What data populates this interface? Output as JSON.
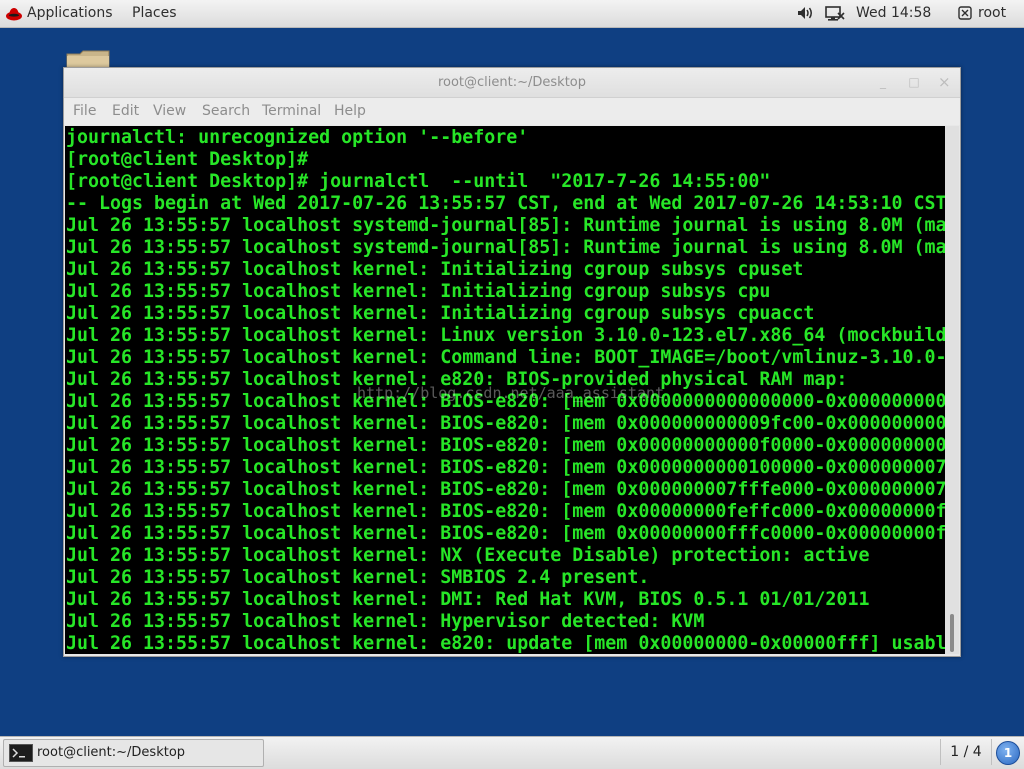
{
  "top_panel": {
    "applications": "Applications",
    "places": "Places",
    "clock": "Wed 14:58",
    "user": "root",
    "icons": [
      "redhat-logo-icon",
      "volume-icon",
      "network-icon",
      "user-icon"
    ]
  },
  "window": {
    "title": "root@client:~/Desktop",
    "controls": {
      "minimize": "_",
      "maximize": "□",
      "close": "×"
    },
    "menu": [
      "File",
      "Edit",
      "View",
      "Search",
      "Terminal",
      "Help"
    ]
  },
  "terminal": {
    "lines": [
      "journalctl: unrecognized option '--before'",
      "[root@client Desktop]#",
      "[root@client Desktop]# journalctl  --until  \"2017-7-26 14:55:00\"",
      "-- Logs begin at Wed 2017-07-26 13:55:57 CST, end at Wed 2017-07-26 14:53:10 CST",
      "Jul 26 13:55:57 localhost systemd-journal[85]: Runtime journal is using 8.0M (ma",
      "Jul 26 13:55:57 localhost systemd-journal[85]: Runtime journal is using 8.0M (ma",
      "Jul 26 13:55:57 localhost kernel: Initializing cgroup subsys cpuset",
      "Jul 26 13:55:57 localhost kernel: Initializing cgroup subsys cpu",
      "Jul 26 13:55:57 localhost kernel: Initializing cgroup subsys cpuacct",
      "Jul 26 13:55:57 localhost kernel: Linux version 3.10.0-123.el7.x86_64 (mockbuild",
      "Jul 26 13:55:57 localhost kernel: Command line: BOOT_IMAGE=/boot/vmlinuz-3.10.0-",
      "Jul 26 13:55:57 localhost kernel: e820: BIOS-provided physical RAM map:",
      "Jul 26 13:55:57 localhost kernel: BIOS-e820: [mem 0x0000000000000000-0x000000000",
      "Jul 26 13:55:57 localhost kernel: BIOS-e820: [mem 0x000000000009fc00-0x000000000",
      "Jul 26 13:55:57 localhost kernel: BIOS-e820: [mem 0x00000000000f0000-0x000000000",
      "Jul 26 13:55:57 localhost kernel: BIOS-e820: [mem 0x0000000000100000-0x000000007",
      "Jul 26 13:55:57 localhost kernel: BIOS-e820: [mem 0x000000007fffe000-0x000000007",
      "Jul 26 13:55:57 localhost kernel: BIOS-e820: [mem 0x00000000feffc000-0x00000000f",
      "Jul 26 13:55:57 localhost kernel: BIOS-e820: [mem 0x00000000fffc0000-0x00000000f",
      "Jul 26 13:55:57 localhost kernel: NX (Execute Disable) protection: active",
      "Jul 26 13:55:57 localhost kernel: SMBIOS 2.4 present.",
      "Jul 26 13:55:57 localhost kernel: DMI: Red Hat KVM, BIOS 0.5.1 01/01/2011",
      "Jul 26 13:55:57 localhost kernel: Hypervisor detected: KVM",
      "Jul 26 13:55:57 localhost kernel: e820: update [mem 0x00000000-0x00000fff] usabl"
    ],
    "text_color": "#27e627",
    "background": "#000000",
    "watermark": "http://blog.csdn.net/aaa_assistant"
  },
  "taskbar": {
    "window_label": "root@client:~/Desktop",
    "workspace": "1 / 4",
    "notification_count": "1"
  },
  "colors": {
    "desktop": "#0f3f82",
    "terminal_green": "#27e627"
  }
}
